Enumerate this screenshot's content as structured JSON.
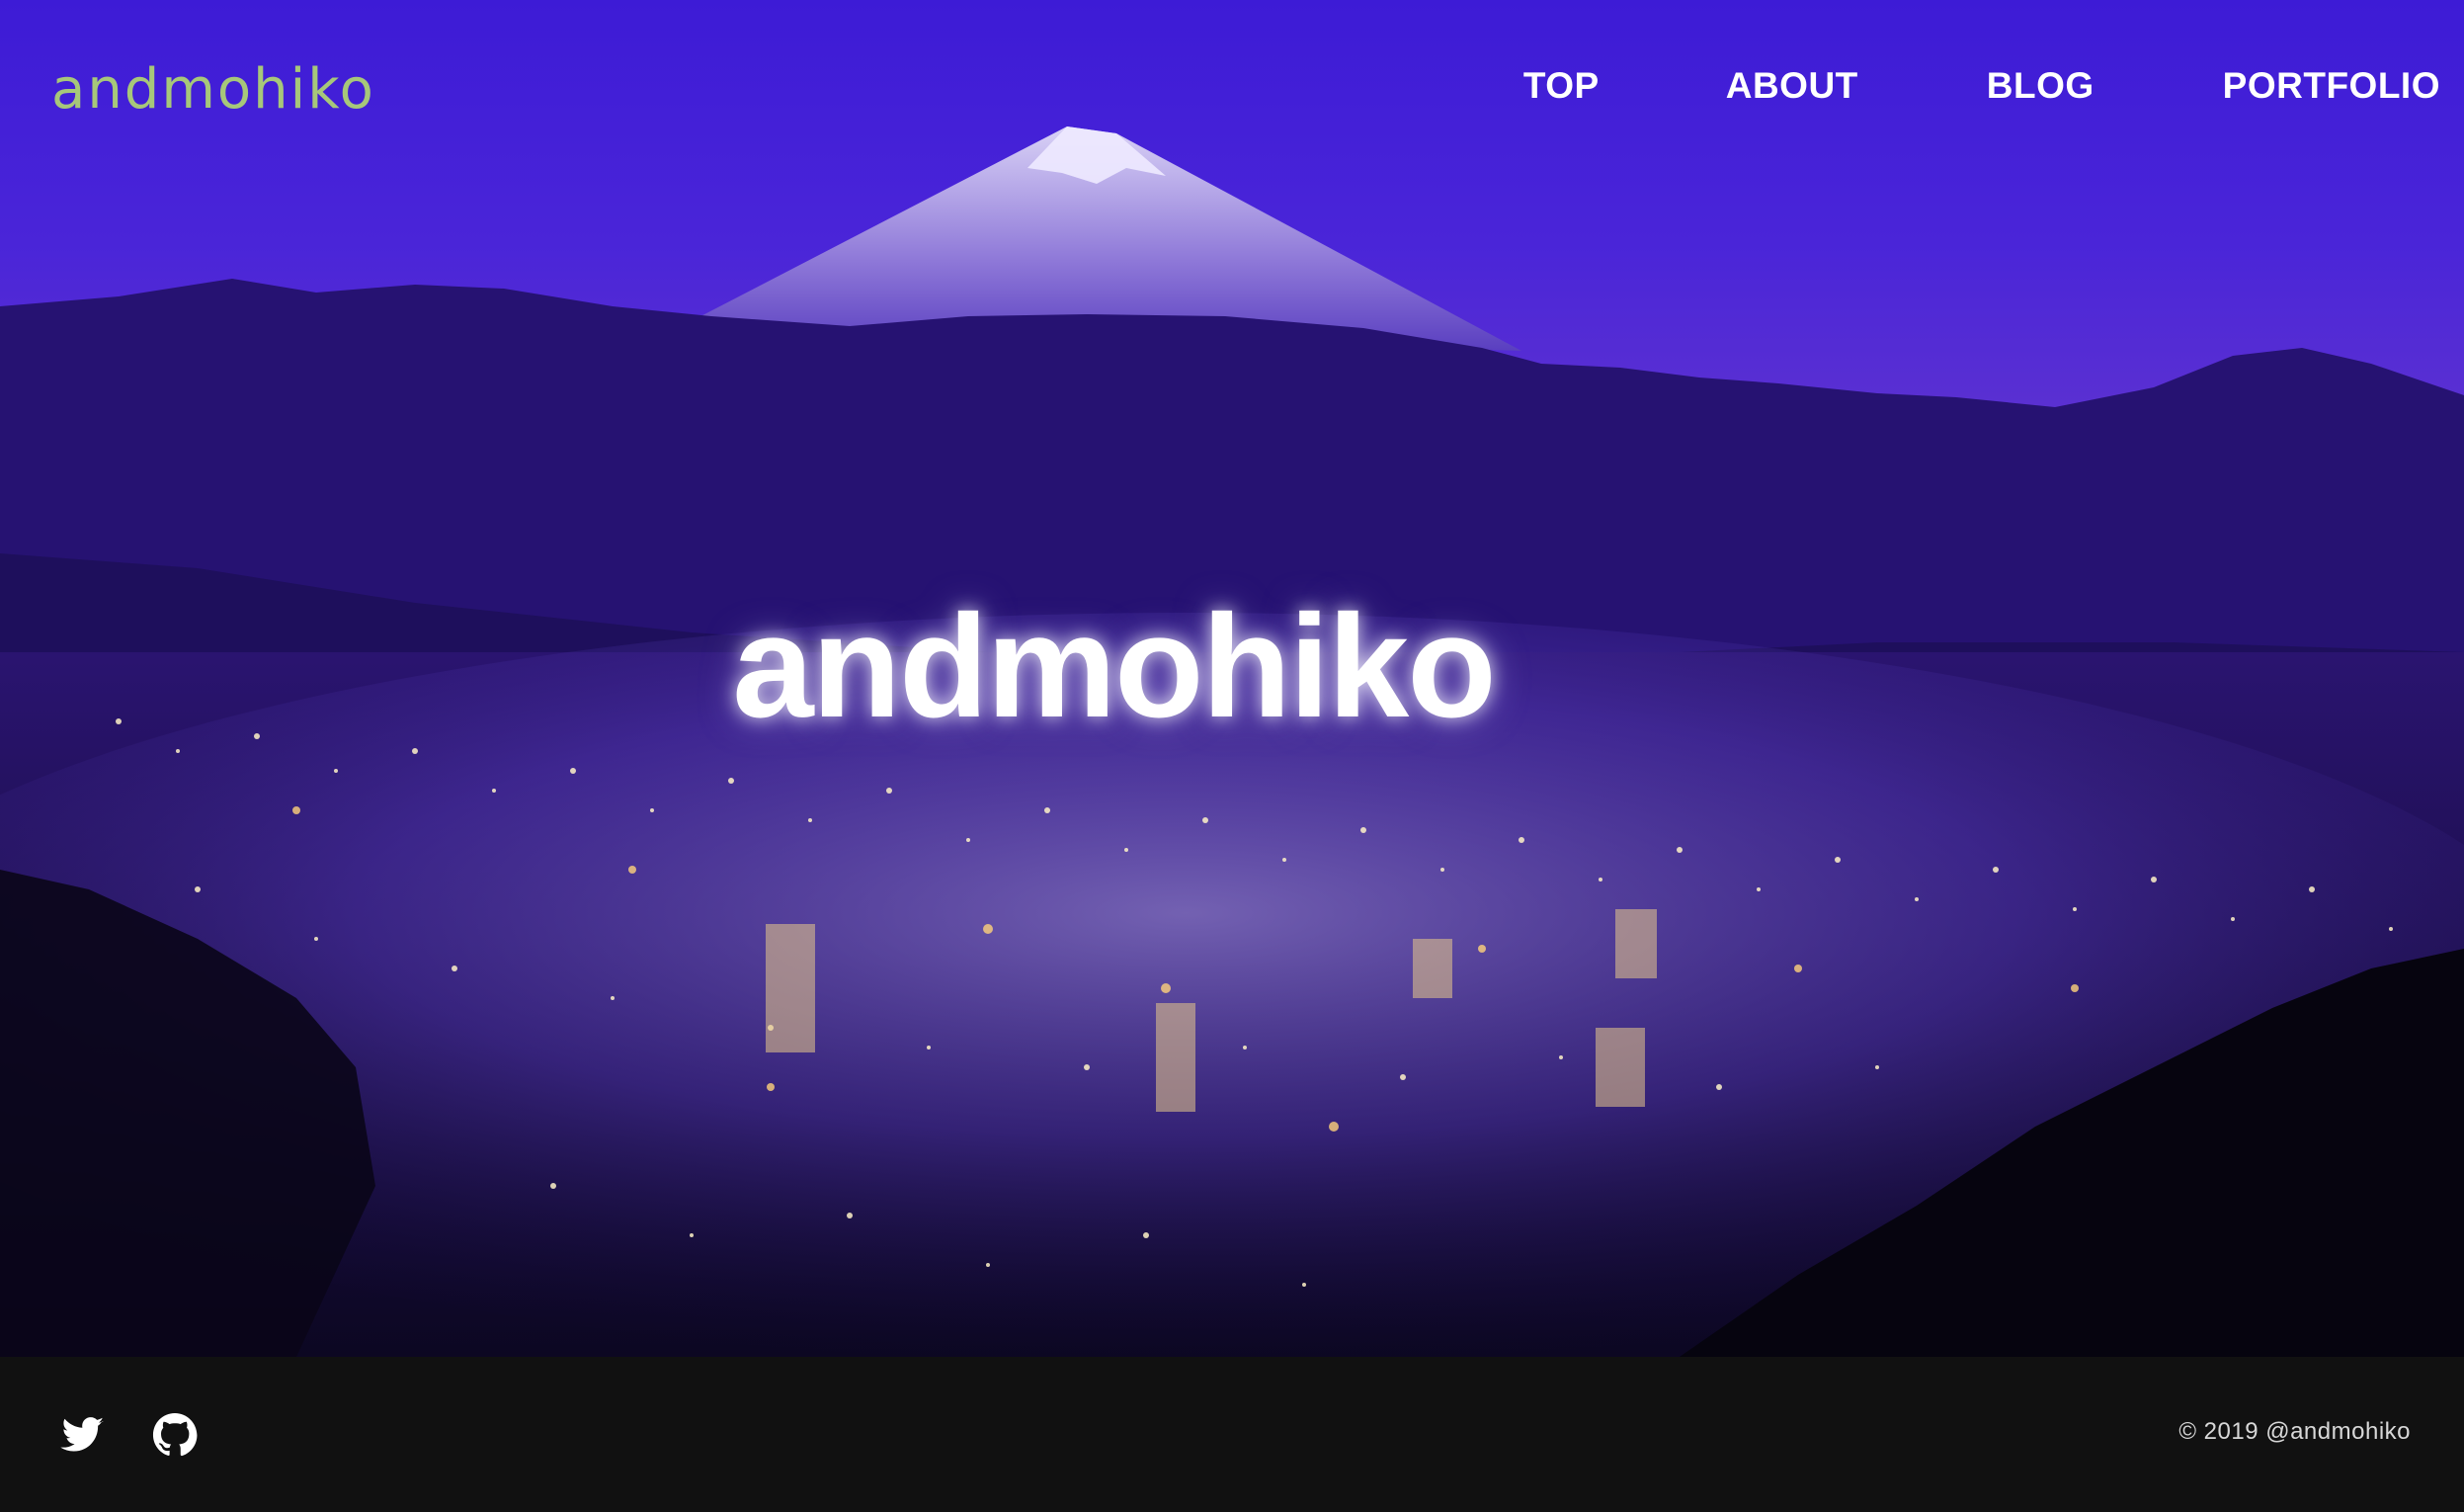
{
  "header": {
    "logo_text": "andmohiko",
    "nav": [
      {
        "label": "TOP"
      },
      {
        "label": "ABOUT"
      },
      {
        "label": "BLOG"
      },
      {
        "label": "PORTFOLIO"
      }
    ]
  },
  "hero": {
    "title": "andmohiko"
  },
  "footer": {
    "social": [
      {
        "icon": "twitter-icon"
      },
      {
        "icon": "github-icon"
      }
    ],
    "copyright": "© 2019 @andmohiko"
  },
  "colors": {
    "logo": "#a7c77a",
    "sky": "#4a25d8",
    "footer_bg": "#111111"
  }
}
